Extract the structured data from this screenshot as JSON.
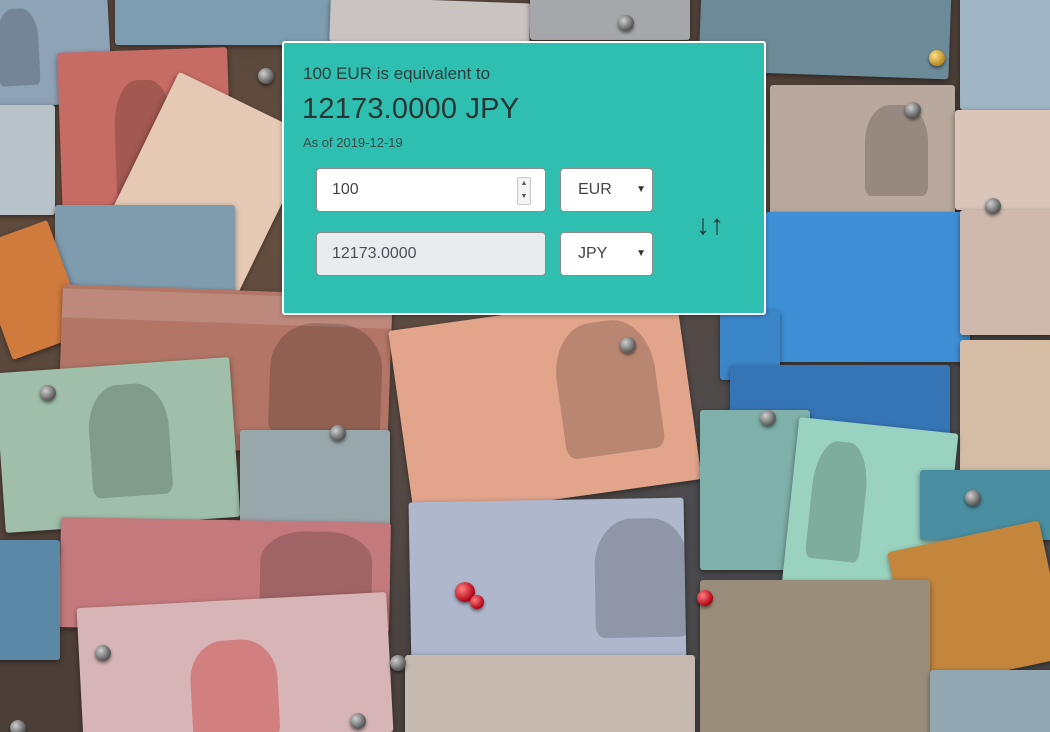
{
  "converter": {
    "summary": "100 EUR is equivalent to",
    "result": "12173.0000 JPY",
    "as_of": "As of 2019-12-19",
    "amount": {
      "value": "100",
      "spinner_up": "▲",
      "spinner_down": "▼"
    },
    "converted": {
      "value": "12173.0000"
    },
    "from_currency": {
      "selected": "EUR",
      "caret": "▼"
    },
    "to_currency": {
      "selected": "JPY",
      "caret": "▼"
    },
    "swap": {
      "glyph": "↓↑"
    }
  },
  "colors": {
    "card_background": "#2ebfb0",
    "card_border": "#ffffff",
    "readonly_field": "#e9ecef"
  },
  "icons": {
    "swap": "swap-arrows-icon",
    "caret": "chevron-down-icon",
    "spinner": "spinner-arrows-icon"
  }
}
